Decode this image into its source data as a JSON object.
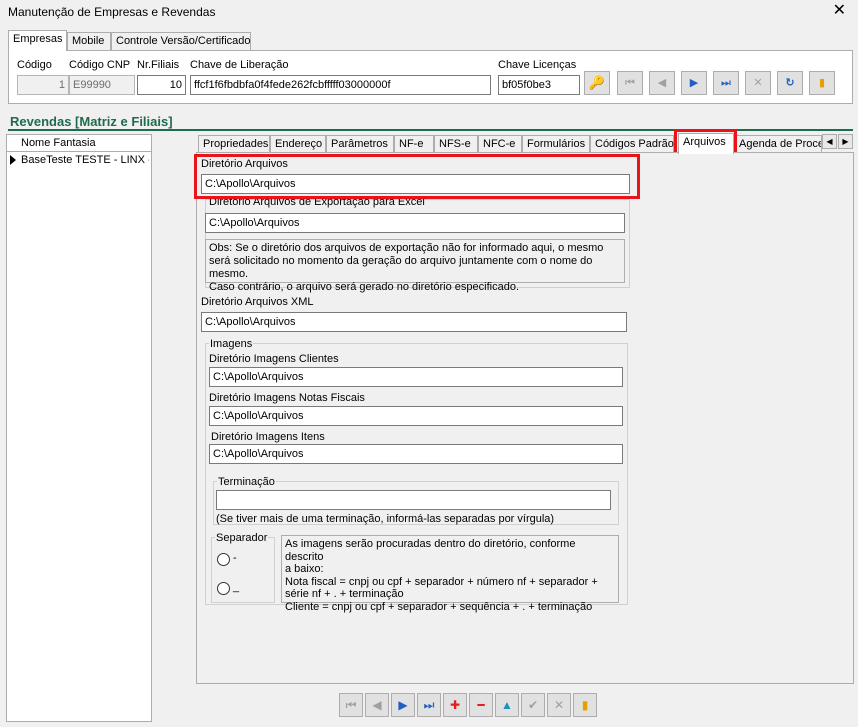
{
  "window": {
    "title": "Manutenção de Empresas e Revendas",
    "close": "✕"
  },
  "top_tabs": [
    {
      "label": "Empresas",
      "active": true
    },
    {
      "label": "Mobile"
    },
    {
      "label": "Controle Versão/Certificado"
    }
  ],
  "header": {
    "codigo_label": "Código",
    "codigo_value": "1",
    "codigo_cnp_label": "Código CNP",
    "codigo_cnp_value": "E99990",
    "nr_filiais_label": "Nr.Filiais",
    "nr_filiais_value": "10",
    "chave_liberacao_label": "Chave de Liberação",
    "chave_liberacao_value": "ffcf1f6fbdbfa0f4fede262fcbfffff03000000f",
    "chave_licencas_label": "Chave Licenças",
    "chave_licencas_value": "bf05f0be3"
  },
  "nav_icons": {
    "key": "🔑",
    "first": "⏮",
    "prev": "◀",
    "next": "▶",
    "last": "⏭",
    "cancel": "✕",
    "refresh": "↻",
    "exit": "▮"
  },
  "section": {
    "title": "Revendas [Matriz e Filiais]"
  },
  "grid": {
    "header": "Nome Fantasia",
    "rows": [
      {
        "nome": "BaseTeste TESTE - LINX - F"
      }
    ]
  },
  "inner_tabs": [
    {
      "label": "Propriedades"
    },
    {
      "label": "Endereço"
    },
    {
      "label": "Parâmetros"
    },
    {
      "label": "NF-e"
    },
    {
      "label": "NFS-e"
    },
    {
      "label": "NFC-e"
    },
    {
      "label": "Formulários"
    },
    {
      "label": "Códigos Padrão"
    },
    {
      "label": "Arquivos",
      "active": true
    },
    {
      "label": "Agenda de Proces"
    }
  ],
  "arquivos": {
    "dir_arquivos_label": "Diretório Arquivos",
    "dir_arquivos_value": "C:\\Apollo\\Arquivos",
    "dir_export_label": "Diretório Arquivos de Exportação para Excel",
    "dir_export_value": "C:\\Apollo\\Arquivos",
    "obs_lines": [
      "Obs: Se o diretório dos arquivos de exportação não  for informado aqui, o  mesmo",
      "será solicitado no momento da geração do arquivo juntamente com o nome do mesmo.",
      "Caso contrário,  o arquivo será gerado no diretório especificado."
    ],
    "dir_xml_label": "Diretório Arquivos XML",
    "dir_xml_value": "C:\\Apollo\\Arquivos",
    "imagens_label": "Imagens",
    "img_clientes_label": "Diretório Imagens Clientes",
    "img_clientes_value": "C:\\Apollo\\Arquivos",
    "img_notas_label": "Diretório Imagens Notas Fiscais",
    "img_notas_value": "C:\\Apollo\\Arquivos",
    "img_itens_label": "Diretório Imagens Itens",
    "img_itens_value": "C:\\Apollo\\Arquivos",
    "terminacao_label": "Terminação",
    "terminacao_value": "",
    "terminacao_hint": "(Se tiver mais de uma terminação, informá-las separadas por vírgula)",
    "separador_label": "Separador",
    "sep_opt1": "-",
    "sep_opt2": "_",
    "info_lines": [
      "As imagens serão procuradas dentro do diretório, conforme descrito",
      "a baixo:",
      "Nota fiscal = cnpj ou cpf  + separador + número nf + separador +",
      "série nf + . + terminação",
      "Cliente = cnpj ou cpf + separador + sequência + . + terminação"
    ]
  },
  "bottom_icons": {
    "first": "⏮",
    "prev": "◀",
    "next": "▶",
    "last": "⏭",
    "add": "✚",
    "remove": "━",
    "up": "▲",
    "confirm": "✔",
    "cancel": "✕",
    "exit": "▮"
  },
  "colors": {
    "section_title": "#1f6b4d",
    "highlight": "#e8141a",
    "nav_blue": "#1f5fbf",
    "add_red": "#e02020"
  }
}
